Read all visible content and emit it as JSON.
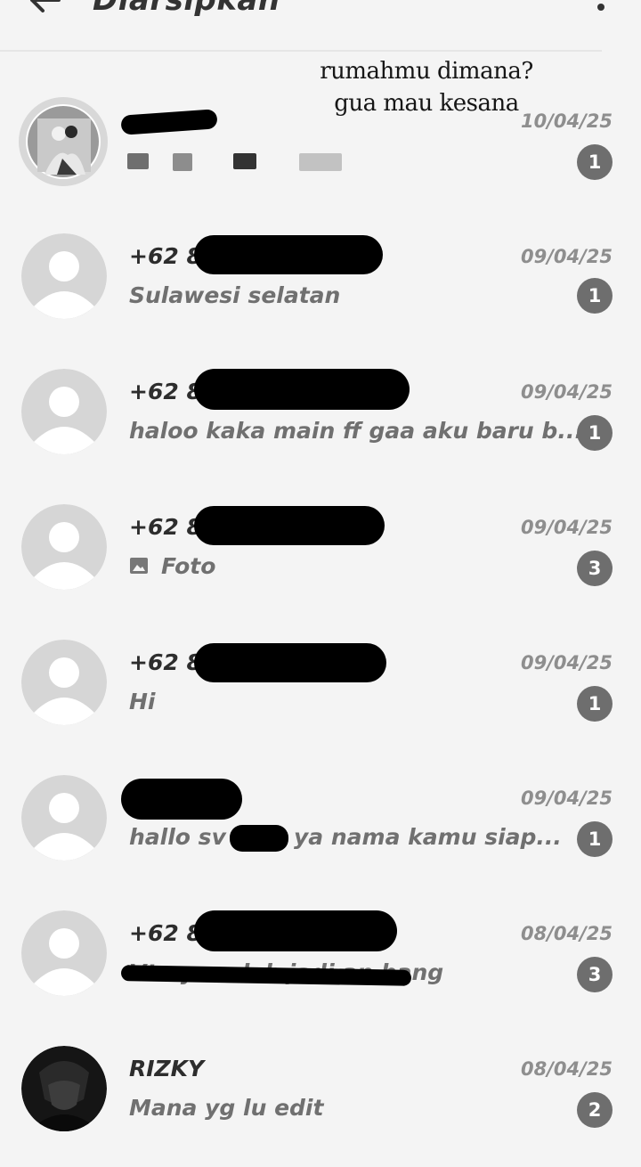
{
  "header": {
    "title": "Diarsipkan"
  },
  "overlay": {
    "line1": "rumahmu dimana?",
    "line2": "gua mau kesana"
  },
  "chats": [
    {
      "name": "",
      "message": "",
      "date": "10/04/25",
      "unread": "1"
    },
    {
      "name": "+62 8",
      "message": "Sulawesi selatan",
      "date": "09/04/25",
      "unread": "1"
    },
    {
      "name": "+62 8",
      "message": "haloo kaka main ff gaa aku baru b...",
      "date": "09/04/25",
      "unread": "1"
    },
    {
      "name": "+62 8",
      "message": "Foto",
      "date": "09/04/25",
      "unread": "3"
    },
    {
      "name": "+62 8",
      "message": "Hi",
      "date": "09/04/25",
      "unread": "1"
    },
    {
      "name": "",
      "message": "hallo  sv",
      "message_tail": "ya nama kamu siap...",
      "date": "09/04/25",
      "unread": "1"
    },
    {
      "name": "+62 8",
      "message": "Vt nya udah jadi an bang",
      "date": "08/04/25",
      "unread": "3"
    },
    {
      "name": "RIZKY",
      "message": "Mana yg lu edit",
      "date": "08/04/25",
      "unread": "2"
    }
  ]
}
